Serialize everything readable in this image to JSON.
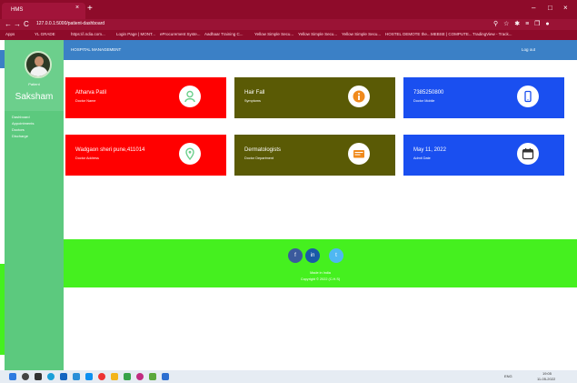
{
  "browser": {
    "tab_title": "HMS",
    "tab_close": "×",
    "new_tab": "+",
    "window_controls": [
      "–",
      "□",
      "×"
    ],
    "nav": [
      "←",
      "→",
      "C"
    ],
    "url": "127.0.0.1:5000/patient-dashboard",
    "bookmarks": [
      "Apps",
      "YL GRADE",
      "https://i.ndia.com...",
      "Login Page | MONT...",
      "eProcurement Syste...",
      "Aadhaar Training C...",
      "Yellow Simple Secu...",
      "Yellow Simple Secu...",
      "Yellow Simple Secu...",
      "HOSTEL DEMOTE the...",
      "MEBSE | COMPUTE...",
      "TradingView - Track..."
    ]
  },
  "sidebar": {
    "caption": "Patient",
    "name": "Saksham",
    "menu": [
      "Dashboard",
      "Appointments",
      "Doctors",
      "Discharge"
    ]
  },
  "header": {
    "title": "HOSPITAL MANAGEMENT",
    "logout": "Log out"
  },
  "cards": [
    {
      "value": "Atharva Patil",
      "label": "Doctor Name",
      "color": "#ff0000",
      "icon": "doctor-icon"
    },
    {
      "value": "Hair Fall",
      "label": "Symptoms",
      "color": "#5a5a05",
      "icon": "info-icon"
    },
    {
      "value": "7385250800",
      "label": "Doctor Mobile",
      "color": "#1a4ff0",
      "icon": "mobile-icon"
    },
    {
      "value": "Wadgaon sheri pune,411014",
      "label": "Doctor Address",
      "color": "#ff0000",
      "icon": "location-icon"
    },
    {
      "value": "Dermatologists",
      "label": "Doctor Department",
      "color": "#5a5a05",
      "icon": "id-card-icon"
    },
    {
      "value": "May 11, 2022",
      "label": "Admit Date",
      "color": "#1a4ff0",
      "icon": "calendar-icon"
    }
  ],
  "footer": {
    "social": [
      "f",
      "in",
      "t"
    ],
    "line1": "Made in India",
    "line2": "Copyright © 2022 (C.H.S)"
  },
  "taskbar": {
    "tray_text": "ENG",
    "time": "19:05",
    "date": "11-05-2022"
  }
}
